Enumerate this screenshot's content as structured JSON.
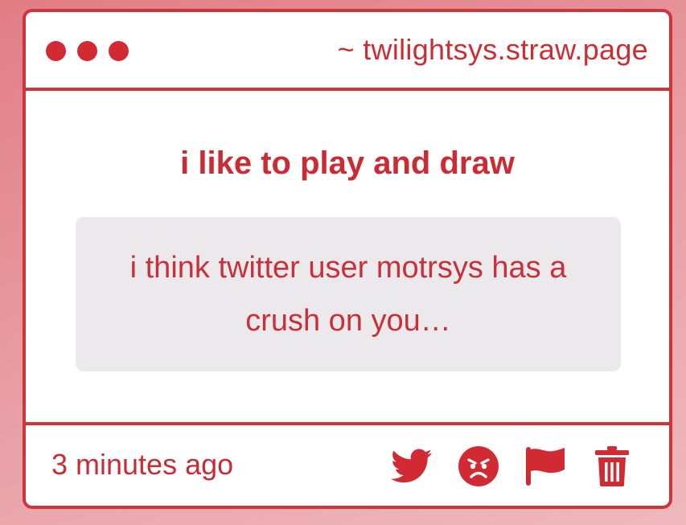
{
  "window": {
    "site_label": "~ twilightsys.straw.page"
  },
  "post": {
    "prompt": "i like to play and draw",
    "message": "i think twitter user motrsys has a crush on you…",
    "timestamp": "3 minutes ago"
  },
  "actions": [
    {
      "icon": "twitter-icon"
    },
    {
      "icon": "angry-face-icon"
    },
    {
      "icon": "flag-icon"
    },
    {
      "icon": "trash-icon"
    }
  ],
  "colors": {
    "accent": "#d13438",
    "message_bg": "#ebe9eb",
    "background": "#e8a0a6"
  }
}
